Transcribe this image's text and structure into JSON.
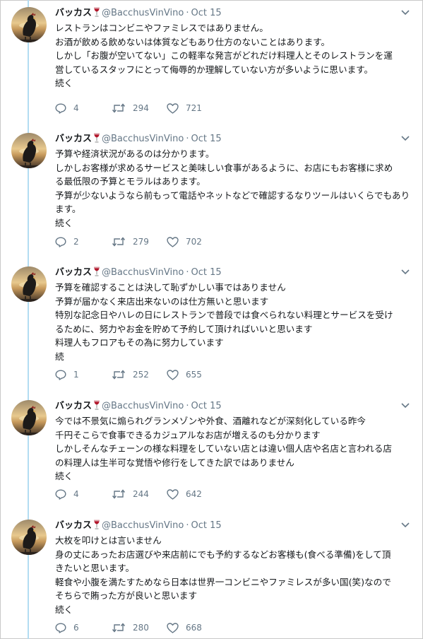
{
  "tweets": [
    {
      "name": "バッカス",
      "handle": "@BacchusVinVino",
      "dot": "·",
      "date": "Oct 15",
      "lines": [
        "レストランはコンビニやファミレスではありません。",
        "お酒が飲める飲めないは体質などもあり仕方のないことはあります。",
        "しかし「お腹が空いてない」この軽率な発言がどれだけ料理人とそのレストランを運",
        "営しているスタッフにとって侮辱的か理解していない方が多いように思います。",
        "続く"
      ],
      "replies": "4",
      "retweets": "294",
      "likes": "721"
    },
    {
      "name": "バッカス",
      "handle": "@BacchusVinVino",
      "dot": "·",
      "date": "Oct 15",
      "lines": [
        "予算や経済状況があるのは分かります。",
        "しかしお客様が求めるサービスと美味しい食事があるように、お店にもお客様に求め",
        "る最低限の予算とモラルはあります。",
        "予算が少ないようなら前もって電話やネットなどで確認するなりツールはいくらでもあり",
        "ます。",
        "続く"
      ],
      "replies": "2",
      "retweets": "279",
      "likes": "702"
    },
    {
      "name": "バッカス",
      "handle": "@BacchusVinVino",
      "dot": "·",
      "date": "Oct 15",
      "lines": [
        "予算を確認することは決して恥ずかしい事ではありません",
        "予算が届かなく来店出来ないのは仕方無いと思います",
        "特別な記念日やハレの日にレストランで普段では食べられない料理とサービスを受け",
        "るために、努力やお金を貯めて予約して頂ければいいと思います",
        "料理人もフロアもその為に努力しています",
        "続"
      ],
      "replies": "1",
      "retweets": "252",
      "likes": "655"
    },
    {
      "name": "バッカス",
      "handle": "@BacchusVinVino",
      "dot": "·",
      "date": "Oct 15",
      "lines": [
        "今では不景気に煽られグランメゾンや外食、酒離れなどが深刻化している昨今",
        "千円そこらで食事できるカジュアルなお店が増えるのも分かります",
        "しかしそんなチェーンの様な料理をしていない店とは違い個人店や名店と言われる店",
        "の料理人は生半可な覚悟や修行をしてきた訳ではありません",
        "続く"
      ],
      "replies": "4",
      "retweets": "244",
      "likes": "642"
    },
    {
      "name": "バッカス",
      "handle": "@BacchusVinVino",
      "dot": "·",
      "date": "Oct 15",
      "lines": [
        "大枚を叩けとは言いません",
        "身の丈にあったお店選びや来店前にでも予約するなどお客様も(食べる準備)をして頂",
        "きたいと思います。",
        "軽食や小腹を満たすためなら日本は世界一コンビニやファミレスが多い国(笑)なので",
        "そちらで賄った方が良いと思います",
        "続く"
      ],
      "replies": "6",
      "retweets": "280",
      "likes": "668"
    }
  ],
  "colors": {
    "text": "#14171a",
    "muted": "#657786",
    "thread": "#b3dcf2",
    "wine": "#b2152a"
  },
  "icons": [
    "reply-icon",
    "retweet-icon",
    "like-icon",
    "chevron-down-icon",
    "wine-glass-icon"
  ]
}
